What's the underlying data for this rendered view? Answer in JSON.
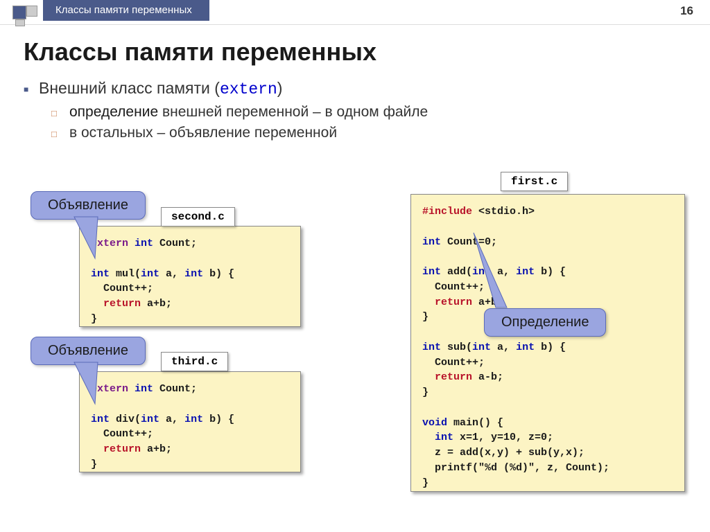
{
  "header": {
    "breadcrumb": "Классы памяти переменных",
    "page": "16"
  },
  "title": "Классы памяти переменных",
  "bullet": {
    "text_before": "Внешний класс памяти (",
    "keyword": "extern",
    "text_after": ")"
  },
  "sub_bullets": [
    {
      "highlight": "определение",
      "rest": " внешней переменной – в одном файле"
    },
    {
      "highlight": "",
      "rest": "в остальных – объявление переменной"
    }
  ],
  "files": {
    "second": {
      "name": "second.c",
      "code_html": "<span class=\"kw-purple\">extern</span> <span class=\"kw-blue\">int</span> Count;\n\n<span class=\"kw-blue\">int</span> mul(<span class=\"kw-blue\">int</span> a, <span class=\"kw-blue\">int</span> b) {\n  Count++;\n  <span class=\"kw-red\">return</span> a+b;\n}"
    },
    "third": {
      "name": "third.c",
      "code_html": "<span class=\"kw-purple\">extern</span> <span class=\"kw-blue\">int</span> Count;\n\n<span class=\"kw-blue\">int</span> div(<span class=\"kw-blue\">int</span> a, <span class=\"kw-blue\">int</span> b) {\n  Count++;\n  <span class=\"kw-red\">return</span> a+b;\n}"
    },
    "first": {
      "name": "first.c",
      "code_html": "<span class=\"kw-red\">#include</span> &lt;stdio.h&gt;\n\n<span class=\"kw-blue\">int</span> Count=0;\n\n<span class=\"kw-blue\">int</span> add(<span class=\"kw-blue\">int</span> a, <span class=\"kw-blue\">int</span> b) {\n  Count++;\n  <span class=\"kw-red\">return</span> a+b;\n}\n\n<span class=\"kw-blue\">int</span> sub(<span class=\"kw-blue\">int</span> a, <span class=\"kw-blue\">int</span> b) {\n  Count++;\n  <span class=\"kw-red\">return</span> a-b;\n}\n\n<span class=\"kw-blue\">void</span> main() {\n  <span class=\"kw-blue\">int</span> x=1, y=10, z=0;\n  z = add(x,y) + sub(y,x);\n  printf(\"%d (%d)\", z, Count);\n}"
    }
  },
  "callouts": {
    "c1": "Объявление",
    "c2": "Объявление",
    "c3": "Определение"
  }
}
